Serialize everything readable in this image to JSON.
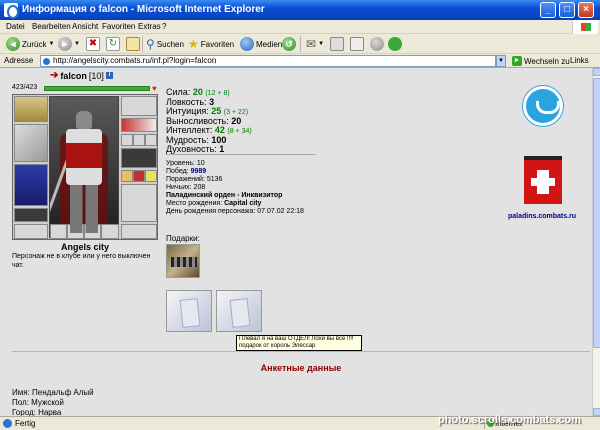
{
  "window": {
    "title": "Информация о falcon - Microsoft Internet Explorer",
    "minimize": "_",
    "maximize": "□",
    "close": "×"
  },
  "menu": [
    "Datei",
    "Bearbeiten",
    "Ansicht",
    "Favoriten",
    "Extras",
    "?"
  ],
  "toolbar": {
    "back": "Zurück",
    "search": "Suchen",
    "favorites": "Favoriten",
    "media": "Medien"
  },
  "address": {
    "label": "Adresse",
    "url": "http://angelscity.combats.ru/inf.pl?login=falcon",
    "go": "Wechseln zu",
    "links": "Links"
  },
  "character": {
    "name": "falcon",
    "level": "[10]",
    "hp": "423/423",
    "hp_fraction": 1.0,
    "city": "Angels city",
    "offline": "Персонаж не в клубе или у него выключен чат."
  },
  "stats": [
    {
      "label": "Сила:",
      "value": "20",
      "bonus": "(12 + 8)",
      "color": "green"
    },
    {
      "label": "Ловкость:",
      "value": "3",
      "bonus": "",
      "color": "black"
    },
    {
      "label": "Интуиция:",
      "value": "25",
      "bonus": "(3 + 22)",
      "color": "green"
    },
    {
      "label": "Выносливость:",
      "value": "20",
      "bonus": "",
      "color": "black"
    },
    {
      "label": "Интеллект:",
      "value": "42",
      "bonus": "(8 + 34)",
      "color": "green"
    },
    {
      "label": "Мудрость:",
      "value": "100",
      "bonus": "",
      "color": "black"
    },
    {
      "label": "Духовность:",
      "value": "1",
      "bonus": "",
      "color": "black"
    }
  ],
  "details": {
    "level": "Уровень: 10",
    "wins_label": "Побед: ",
    "wins": "9989",
    "losses": "Поражений: 5136",
    "draws": "Ничьих: 208",
    "order": "Паладинский орден",
    "order_rank": " - Инквизитор",
    "birthplace_label": "Место рождения: ",
    "birthplace": "Capital city",
    "birthday": "День рождения персонажа: 07.07.02 22:18"
  },
  "gifts": {
    "label": "Подарки:",
    "tooltip_line1": "Плевал я на ваш ОТДЕЛ! Лохи вы все !!!!",
    "tooltip_line2": "подарок от король Элессар"
  },
  "anketa": {
    "title": "Анкетные данные",
    "name": "Имя: Пендальф Алый",
    "sex": "Пол: Мужской",
    "city": "Город: Нарва"
  },
  "sidebar": {
    "banner_url": "paladins.combats.ru"
  },
  "watermark": "photo.scrolls.combats.com",
  "status": {
    "text": "Fertig",
    "zone": "Internet"
  },
  "colors": {
    "hp_bar": "#3cae2e",
    "stat_bonus": "#008000",
    "anketa_title": "#8b0000",
    "paladin_banner": "#d21414"
  }
}
